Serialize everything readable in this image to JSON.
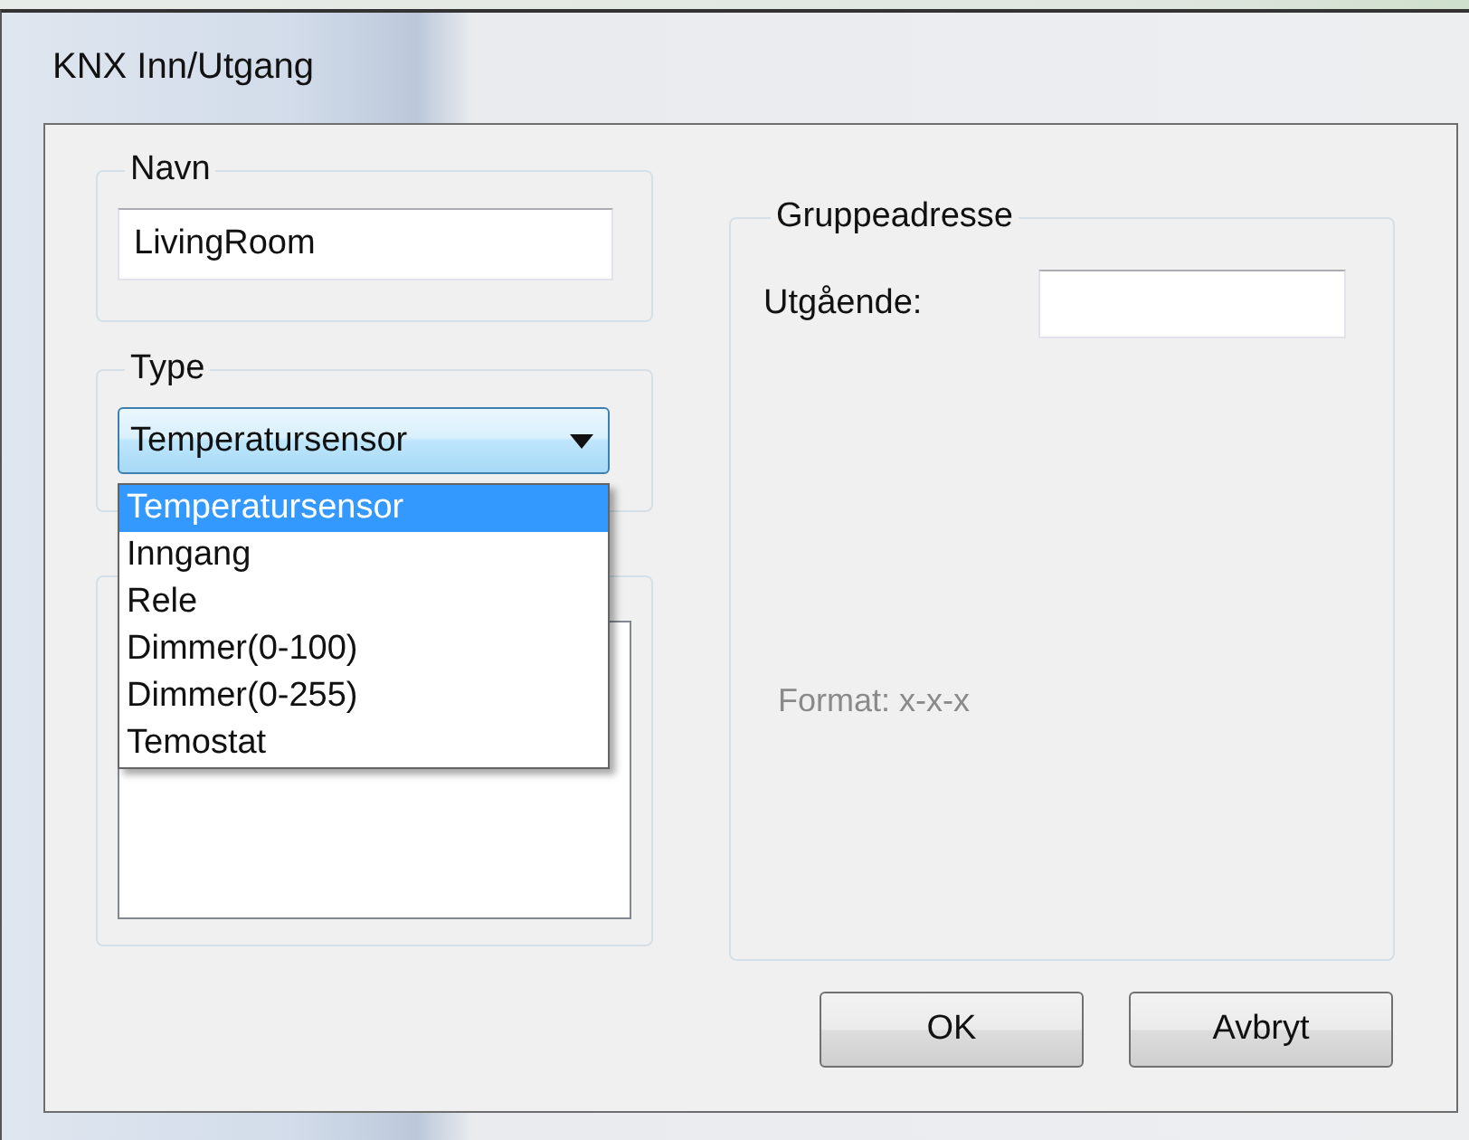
{
  "window": {
    "title": "KNX Inn/Utgang"
  },
  "name_group": {
    "label": "Navn",
    "value": "LivingRoom"
  },
  "type_group": {
    "label": "Type",
    "value": "Temperatursensor",
    "expanded": true,
    "options": [
      {
        "label": "Temperatursensor",
        "selected": true
      },
      {
        "label": "Inngang",
        "selected": false
      },
      {
        "label": "Rele",
        "selected": false
      },
      {
        "label": "Dimmer(0-100)",
        "selected": false
      },
      {
        "label": "Dimmer(0-255)",
        "selected": false
      },
      {
        "label": "Temostat",
        "selected": false
      }
    ]
  },
  "group_address": {
    "label": "Gruppeadresse",
    "outgoing_label": "Utgående:",
    "hint": "Format: x-x-x"
  },
  "buttons": [
    "OK",
    "Avbryt"
  ]
}
